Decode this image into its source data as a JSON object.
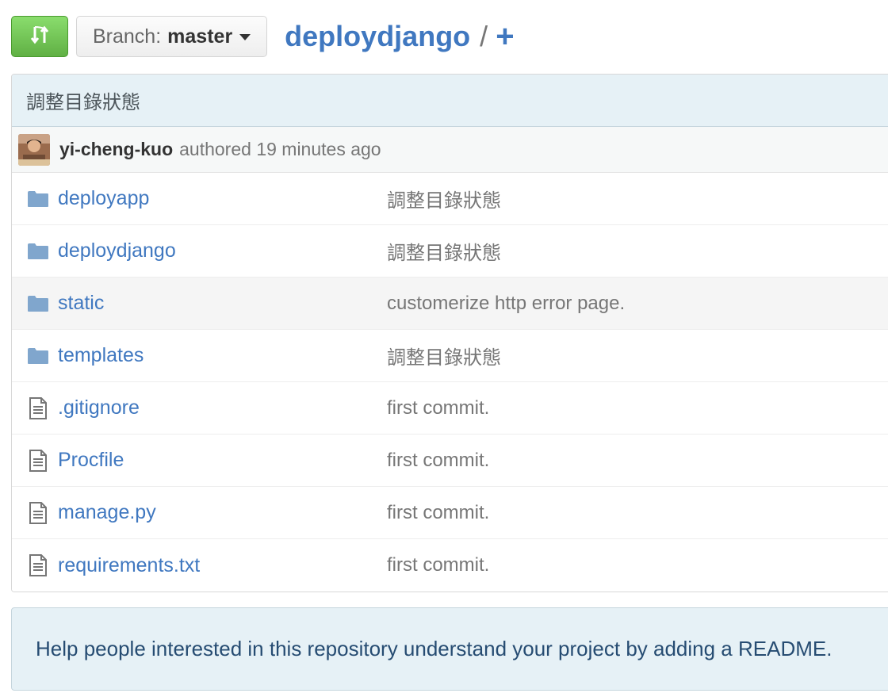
{
  "toolbar": {
    "branch_prefix": "Branch:",
    "branch_name": "master",
    "repo_name": "deploydjango",
    "separator": "/",
    "plus": "+"
  },
  "commit": {
    "message": "調整目錄狀態",
    "author": "yi-cheng-kuo",
    "authored_text": "authored 19 minutes ago"
  },
  "files": [
    {
      "name": "deployapp",
      "type": "folder",
      "message": "調整目錄狀態"
    },
    {
      "name": "deploydjango",
      "type": "folder",
      "message": "調整目錄狀態"
    },
    {
      "name": "static",
      "type": "folder",
      "message": "customerize http error page."
    },
    {
      "name": "templates",
      "type": "folder",
      "message": "調整目錄狀態"
    },
    {
      "name": ".gitignore",
      "type": "file",
      "message": "first commit."
    },
    {
      "name": "Procfile",
      "type": "file",
      "message": "first commit."
    },
    {
      "name": "manage.py",
      "type": "file",
      "message": "first commit."
    },
    {
      "name": "requirements.txt",
      "type": "file",
      "message": "first commit."
    }
  ],
  "readme": {
    "text": "Help people interested in this repository understand your project by adding a README."
  },
  "colors": {
    "link": "#4078c0",
    "green_button": "#6cc644",
    "commit_bg": "#e6f1f6"
  }
}
